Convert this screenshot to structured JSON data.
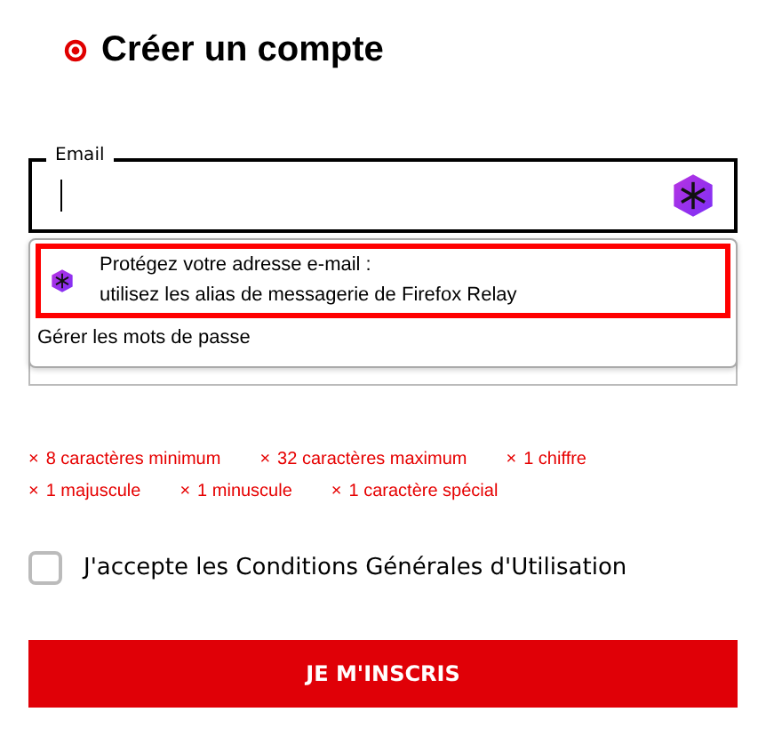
{
  "heading": {
    "title": "Créer un compte"
  },
  "email_field": {
    "label": "Email",
    "focused": true
  },
  "autocomplete_menu": {
    "items": [
      {
        "kind": "relay",
        "line_1": "Protégez votre adresse e-mail :",
        "line_2": "utilisez les alias de messagerie de Firefox Relay",
        "selected": true
      },
      {
        "kind": "plain",
        "line_1": "Gérer les mots de passe",
        "selected": false
      }
    ]
  },
  "password_rules": [
    {
      "mark": "×",
      "text": "8 caractères minimum",
      "met": false
    },
    {
      "mark": "×",
      "text": "32 caractères maximum",
      "met": false
    },
    {
      "mark": "×",
      "text": "1 chiffre",
      "met": false
    },
    {
      "mark": "×",
      "text": "1 majuscule",
      "met": false
    },
    {
      "mark": "×",
      "text": "1 minuscule",
      "met": false
    },
    {
      "mark": "×",
      "text": "1 caractère spécial",
      "met": false
    }
  ],
  "terms": {
    "label": "J'accepte les Conditions Générales d'Utilisation",
    "checked": false
  },
  "submit_button": {
    "label": "JE M'INSCRIS"
  }
}
